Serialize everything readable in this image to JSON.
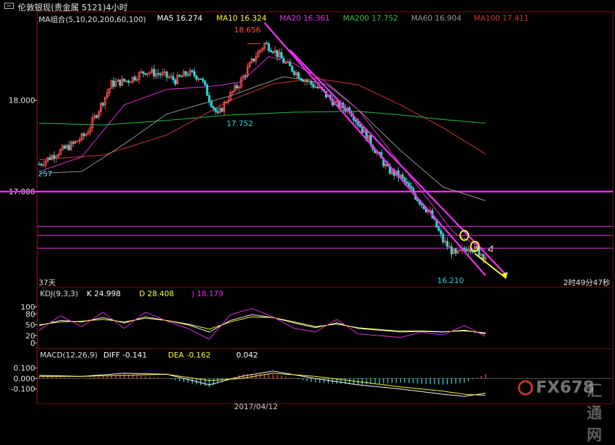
{
  "window": {
    "title": "伦敦银现(贵金属 5121)4小时"
  },
  "colors": {
    "bg": "#000000",
    "up": "#ff5050",
    "down": "#37d3d3",
    "grid": "#7a0f0f",
    "channel": "#e52fe5",
    "hline": "#e52fe5",
    "yellow": "#ffff33",
    "axis": "#cfcfcf"
  },
  "main_header": {
    "combo": "MA组合(5,10,20,200,60,100)",
    "ma5": "MA5 16.274",
    "ma10": "MA10 16.324",
    "ma20": "MA20 16.361",
    "ma200": "MA200 17.752",
    "ma60": "MA60 16.904",
    "ma100": "MA100 17.411"
  },
  "kdj_header": {
    "name": "KDJ(9,3,3)",
    "k": "K   24.998",
    "d": "D   28.408",
    "j": "J   18.179"
  },
  "macd_header": {
    "name": "MACD(12,26,9)",
    "diff": "DIFF  -0.141",
    "dea": "DEA  -0.162",
    "macd": "0.042"
  },
  "annotations": {
    "high": "18.656",
    "low_mid": "17.752",
    "low_end": "16.210",
    "left_val": "257",
    "period": "37天",
    "countdown": "2时49分47秒"
  },
  "x_axis": {
    "date": "2017/04/12"
  },
  "watermark": {
    "text": "FX678",
    "cn": "汇通网"
  },
  "chart_data": [
    {
      "type": "candlestick",
      "series_name": "伦敦银现",
      "y_ticks": [
        18.0,
        17.0
      ],
      "y_tick_labels": [
        "18.000",
        "17.000"
      ],
      "ylim": [
        16.08,
        18.85
      ],
      "anchors": [
        [
          0,
          17.3
        ],
        [
          8,
          17.42
        ],
        [
          16,
          17.52
        ],
        [
          22,
          17.63
        ],
        [
          28,
          17.9
        ],
        [
          34,
          18.18
        ],
        [
          42,
          18.22
        ],
        [
          50,
          18.32
        ],
        [
          58,
          18.28
        ],
        [
          64,
          18.22
        ],
        [
          70,
          18.3
        ],
        [
          76,
          18.25
        ],
        [
          80,
          18.02
        ],
        [
          84,
          17.83
        ],
        [
          88,
          18.0
        ],
        [
          94,
          18.18
        ],
        [
          100,
          18.42
        ],
        [
          106,
          18.62
        ],
        [
          110,
          18.56
        ],
        [
          116,
          18.4
        ],
        [
          124,
          18.24
        ],
        [
          132,
          18.12
        ],
        [
          140,
          17.95
        ],
        [
          146,
          17.9
        ],
        [
          152,
          17.68
        ],
        [
          158,
          17.46
        ],
        [
          164,
          17.24
        ],
        [
          170,
          17.16
        ],
        [
          178,
          16.92
        ],
        [
          184,
          16.76
        ],
        [
          190,
          16.46
        ],
        [
          196,
          16.3
        ],
        [
          202,
          16.4
        ],
        [
          206,
          16.35
        ],
        [
          210,
          16.29
        ]
      ],
      "last_index": 210,
      "ma_series": [
        {
          "name": "MA200",
          "color": "#22c63f",
          "points": [
            [
              0,
              17.75
            ],
            [
              30,
              17.73
            ],
            [
              60,
              17.78
            ],
            [
              90,
              17.84
            ],
            [
              120,
              17.87
            ],
            [
              150,
              17.88
            ],
            [
              170,
              17.84
            ],
            [
              190,
              17.79
            ],
            [
              210,
              17.75
            ]
          ]
        },
        {
          "name": "MA100",
          "color": "#d63a2a",
          "points": [
            [
              0,
              17.35
            ],
            [
              30,
              17.4
            ],
            [
              60,
              17.62
            ],
            [
              90,
              18.0
            ],
            [
              110,
              18.18
            ],
            [
              130,
              18.24
            ],
            [
              150,
              18.17
            ],
            [
              170,
              17.95
            ],
            [
              190,
              17.7
            ],
            [
              210,
              17.41
            ]
          ]
        },
        {
          "name": "MA60",
          "color": "#9a9a9a",
          "points": [
            [
              0,
              17.2
            ],
            [
              20,
              17.22
            ],
            [
              40,
              17.52
            ],
            [
              60,
              17.85
            ],
            [
              90,
              18.05
            ],
            [
              115,
              18.26
            ],
            [
              135,
              18.18
            ],
            [
              150,
              17.9
            ],
            [
              170,
              17.45
            ],
            [
              190,
              17.05
            ],
            [
              210,
              16.9
            ]
          ]
        },
        {
          "name": "MA20",
          "color": "#e52fe5",
          "points": [
            [
              0,
              17.22
            ],
            [
              20,
              17.38
            ],
            [
              40,
              17.95
            ],
            [
              60,
              18.12
            ],
            [
              80,
              18.15
            ],
            [
              95,
              18.2
            ],
            [
              108,
              18.48
            ],
            [
              120,
              18.4
            ],
            [
              135,
              18.2
            ],
            [
              150,
              17.9
            ],
            [
              165,
              17.45
            ],
            [
              180,
              17.0
            ],
            [
              195,
              16.55
            ],
            [
              210,
              16.36
            ]
          ]
        }
      ],
      "channel_lines": [
        {
          "from": [
            106,
            18.85
          ],
          "to": [
            210,
            16.08
          ]
        },
        {
          "from": [
            118,
            18.55
          ],
          "to": [
            215,
            16.08
          ]
        }
      ],
      "horizontal_lines": [
        17.0,
        16.62,
        16.52,
        16.38
      ],
      "yellow_markers": [
        {
          "type": "circle",
          "at": [
            200,
            16.52
          ]
        },
        {
          "type": "circle",
          "at": [
            205,
            16.4
          ]
        },
        {
          "type": "arrow",
          "from": [
            205,
            16.32
          ],
          "to": [
            210,
            16.08
          ]
        }
      ]
    },
    {
      "type": "line",
      "series_name": "KDJ",
      "y_ticks": [
        100,
        80,
        50,
        20,
        0
      ],
      "y_tick_labels": [
        "100",
        "80",
        "50",
        "20",
        "0"
      ],
      "ylim": [
        -10,
        110
      ],
      "series": [
        {
          "name": "K",
          "color": "#ffffff",
          "points": [
            [
              0,
              48
            ],
            [
              10,
              62
            ],
            [
              20,
              58
            ],
            [
              30,
              70
            ],
            [
              40,
              55
            ],
            [
              50,
              72
            ],
            [
              60,
              62
            ],
            [
              70,
              50
            ],
            [
              80,
              30
            ],
            [
              90,
              62
            ],
            [
              100,
              78
            ],
            [
              110,
              70
            ],
            [
              120,
              55
            ],
            [
              130,
              42
            ],
            [
              140,
              55
            ],
            [
              150,
              40
            ],
            [
              160,
              35
            ],
            [
              170,
              30
            ],
            [
              180,
              32
            ],
            [
              190,
              30
            ],
            [
              200,
              35
            ],
            [
              210,
              25
            ]
          ]
        },
        {
          "name": "D",
          "color": "#ffff33",
          "points": [
            [
              0,
              50
            ],
            [
              10,
              58
            ],
            [
              20,
              60
            ],
            [
              30,
              65
            ],
            [
              40,
              58
            ],
            [
              50,
              68
            ],
            [
              60,
              62
            ],
            [
              70,
              52
            ],
            [
              80,
              38
            ],
            [
              90,
              58
            ],
            [
              100,
              72
            ],
            [
              110,
              70
            ],
            [
              120,
              58
            ],
            [
              130,
              45
            ],
            [
              140,
              52
            ],
            [
              150,
              42
            ],
            [
              160,
              37
            ],
            [
              170,
              33
            ],
            [
              180,
              33
            ],
            [
              190,
              31
            ],
            [
              200,
              33
            ],
            [
              210,
              28
            ]
          ]
        },
        {
          "name": "J",
          "color": "#e52fe5",
          "points": [
            [
              0,
              35
            ],
            [
              10,
              75
            ],
            [
              20,
              45
            ],
            [
              30,
              85
            ],
            [
              40,
              40
            ],
            [
              50,
              85
            ],
            [
              60,
              60
            ],
            [
              70,
              40
            ],
            [
              80,
              10
            ],
            [
              90,
              78
            ],
            [
              100,
              95
            ],
            [
              110,
              72
            ],
            [
              120,
              40
            ],
            [
              130,
              30
            ],
            [
              140,
              65
            ],
            [
              150,
              25
            ],
            [
              160,
              20
            ],
            [
              170,
              15
            ],
            [
              180,
              30
            ],
            [
              190,
              22
            ],
            [
              200,
              48
            ],
            [
              210,
              18
            ]
          ]
        }
      ]
    },
    {
      "type": "line",
      "series_name": "MACD",
      "y_ticks": [
        0.1,
        0.0,
        -0.1
      ],
      "y_tick_labels": [
        "0.100",
        "0.000",
        "-0.100"
      ],
      "ylim": [
        -0.22,
        0.16
      ],
      "series": [
        {
          "name": "DIFF",
          "color": "#ffffff",
          "points": [
            [
              0,
              0.03
            ],
            [
              20,
              0.02
            ],
            [
              40,
              0.05
            ],
            [
              60,
              0.04
            ],
            [
              80,
              -0.06
            ],
            [
              95,
              0.02
            ],
            [
              110,
              0.07
            ],
            [
              130,
              0.0
            ],
            [
              150,
              -0.06
            ],
            [
              170,
              -0.1
            ],
            [
              190,
              -0.15
            ],
            [
              200,
              -0.17
            ],
            [
              210,
              -0.14
            ]
          ]
        },
        {
          "name": "DEA",
          "color": "#ffff33",
          "points": [
            [
              0,
              0.02
            ],
            [
              20,
              0.02
            ],
            [
              40,
              0.03
            ],
            [
              60,
              0.04
            ],
            [
              80,
              -0.02
            ],
            [
              95,
              0.0
            ],
            [
              110,
              0.05
            ],
            [
              130,
              0.02
            ],
            [
              150,
              -0.03
            ],
            [
              170,
              -0.08
            ],
            [
              190,
              -0.12
            ],
            [
              200,
              -0.15
            ],
            [
              210,
              -0.16
            ]
          ]
        }
      ]
    }
  ]
}
